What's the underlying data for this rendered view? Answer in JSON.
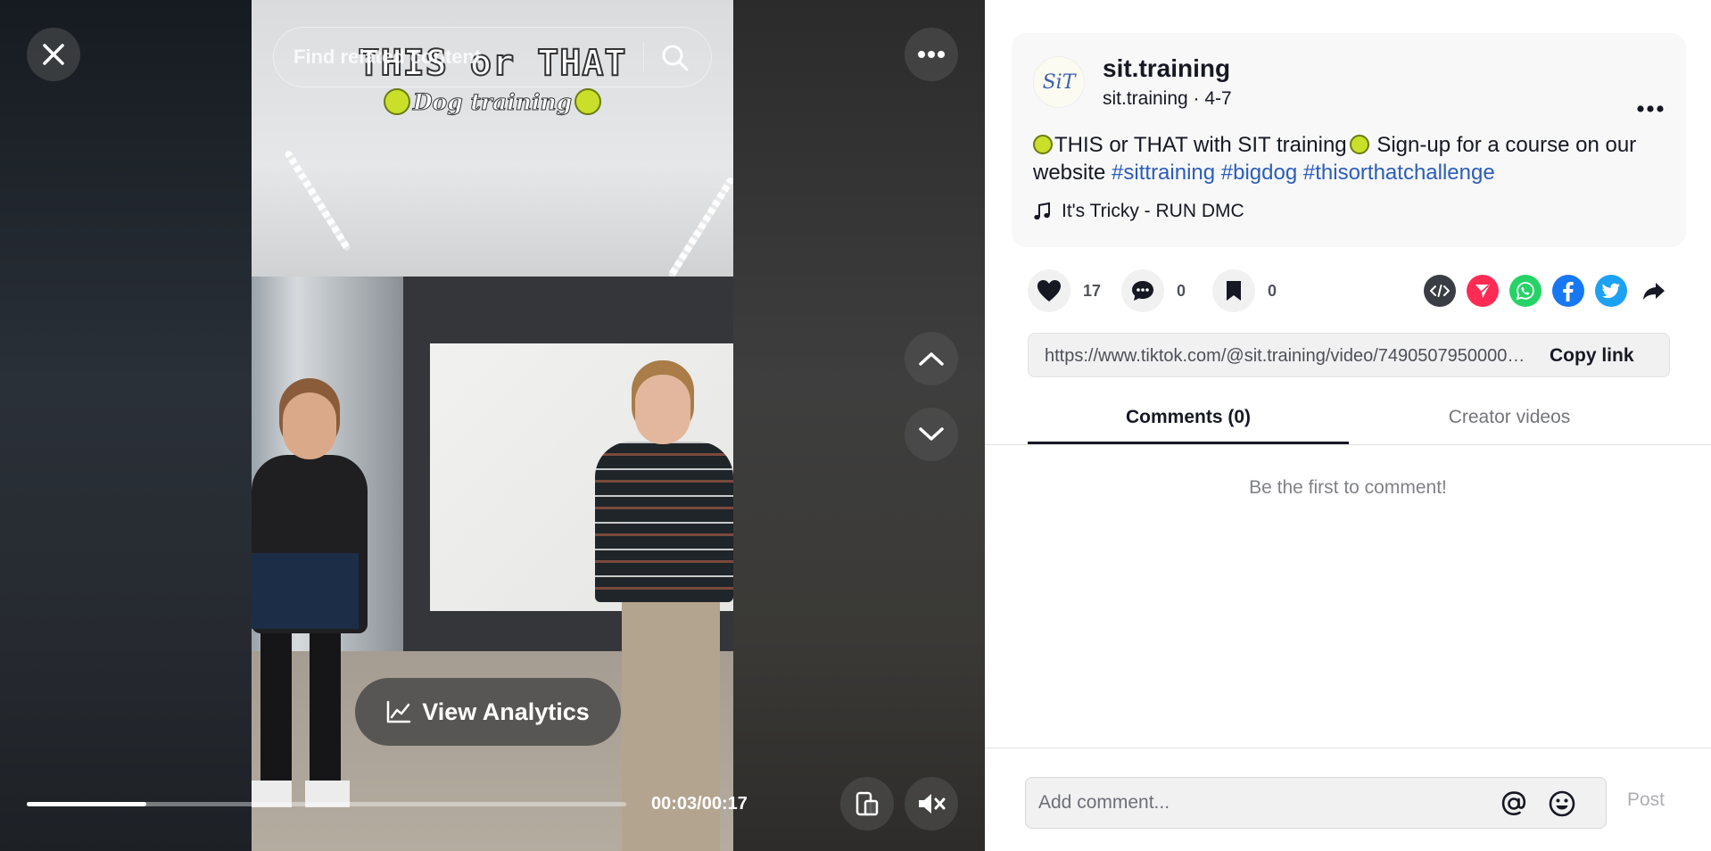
{
  "video": {
    "overlay_title": "THIS or THAT",
    "overlay_subtitle": "Dog training",
    "search": {
      "placeholder": "Find related content"
    },
    "analytics_button": {
      "label": "View Analytics",
      "icon": "chart-line-icon"
    },
    "progress": {
      "current": "00:03",
      "total": "00:17",
      "fraction": 0.2,
      "readout": "00:03/00:17"
    },
    "controls": {
      "close": "close-icon",
      "more": "more-horizontal-icon",
      "previous": "chevron-up-icon",
      "next": "chevron-down-icon",
      "display_mode": "phone-screen-icon",
      "volume": "volume-muted-icon"
    }
  },
  "post": {
    "avatar_text": "SiT",
    "author_name": "sit.training",
    "author_meta": "sit.training · 4-7",
    "description": {
      "text_part1": "THIS or THAT with SIT training",
      "text_part2": " Sign-up for a course on our website ",
      "hashtags": [
        "#sittraining",
        "#bigdog",
        "#thisorthatchallenge"
      ]
    },
    "music": {
      "icon": "music-note-icon",
      "label": "It's Tricky - RUN DMC"
    }
  },
  "actions": {
    "likes": {
      "icon": "heart-icon",
      "count": "17"
    },
    "comments": {
      "icon": "comment-icon",
      "count": "0"
    },
    "saves": {
      "icon": "bookmark-icon",
      "count": "0"
    },
    "share": [
      {
        "icon": "embed-icon",
        "color": "#3a3d44"
      },
      {
        "icon": "send-friends-icon",
        "color": "#fe2c55"
      },
      {
        "icon": "whatsapp-icon",
        "color": "#25d366"
      },
      {
        "icon": "facebook-icon",
        "color": "#1877f2"
      },
      {
        "icon": "twitter-icon",
        "color": "#1da1f2"
      },
      {
        "icon": "share-arrow-icon",
        "color": "#161823"
      }
    ]
  },
  "link": {
    "url": "https://www.tiktok.com/@sit.training/video/7490507950000000000",
    "copy_label": "Copy link"
  },
  "tabs": [
    {
      "label": "Comments (0)",
      "active": true
    },
    {
      "label": "Creator videos",
      "active": false
    }
  ],
  "comments": {
    "empty_message": "Be the first to comment!",
    "composer_placeholder": "Add comment...",
    "post_label": "Post"
  }
}
